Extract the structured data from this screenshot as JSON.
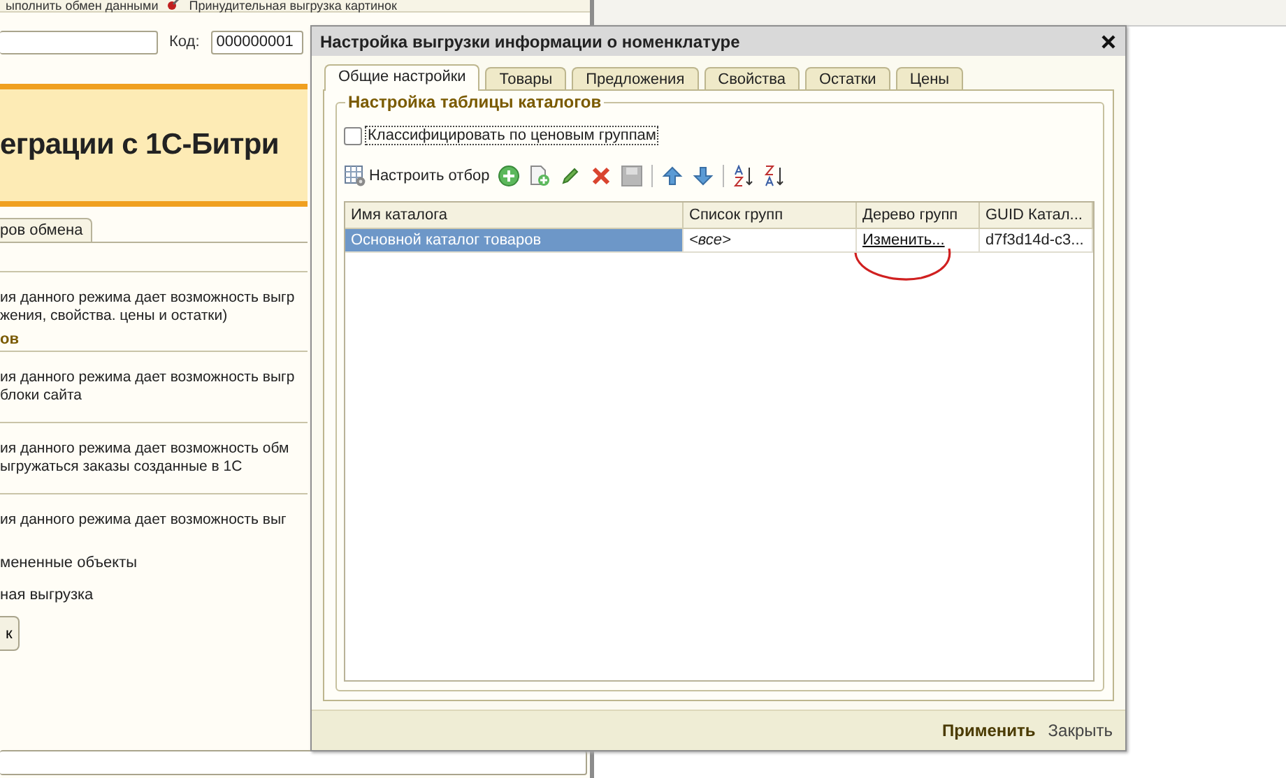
{
  "background_window": {
    "toolbar": [
      "ыполнить обмен данными",
      "Принудительная выгрузка картинок"
    ],
    "code_label": "Код:",
    "code_value": "000000001",
    "banner_title": "еграции с 1С-Битри",
    "tabs": [
      {
        "label": "ров обмена",
        "selected": true
      }
    ],
    "blocks": [
      {
        "kind": "text",
        "text": "ия данного режима дает возможность выгр\nжения, свойства. цены и остатки)"
      },
      {
        "kind": "heading",
        "text": "ов"
      },
      {
        "kind": "text",
        "text": "ия данного режима дает возможность выгр\nблоки сайта"
      },
      {
        "kind": "text",
        "text": "ия данного режима дает возможность обм\nыгружаться заказы созданные в 1С"
      },
      {
        "kind": "text",
        "text": "ия данного режима дает возможность выг"
      },
      {
        "kind": "option",
        "text": "мененные объекты"
      },
      {
        "kind": "option",
        "text": "ная выгрузка"
      },
      {
        "kind": "button",
        "text": "к"
      }
    ]
  },
  "dialog": {
    "title": "Настройка выгрузки информации о номенклатуре",
    "tabs": [
      {
        "label": "Общие настройки",
        "selected": true
      },
      {
        "label": "Товары",
        "selected": false
      },
      {
        "label": "Предложения",
        "selected": false
      },
      {
        "label": "Свойства",
        "selected": false
      },
      {
        "label": "Остатки",
        "selected": false
      },
      {
        "label": "Цены",
        "selected": false
      }
    ],
    "group_title": "Настройка таблицы каталогов",
    "checkbox": {
      "label": "Классифицировать по ценовым группам",
      "checked": false
    },
    "filter_button": "Настроить отбор",
    "table": {
      "columns": [
        "Имя каталога",
        "Список групп",
        "Дерево групп",
        "GUID Катал..."
      ],
      "rows": [
        {
          "selected": true,
          "cells": [
            "Основной каталог товаров",
            "<все>",
            "Изменить...",
            "d7f3d14d-c3..."
          ]
        }
      ]
    },
    "footer_buttons": [
      {
        "label": "Применить",
        "primary": true
      },
      {
        "label": "Закрыть",
        "primary": false
      }
    ]
  }
}
